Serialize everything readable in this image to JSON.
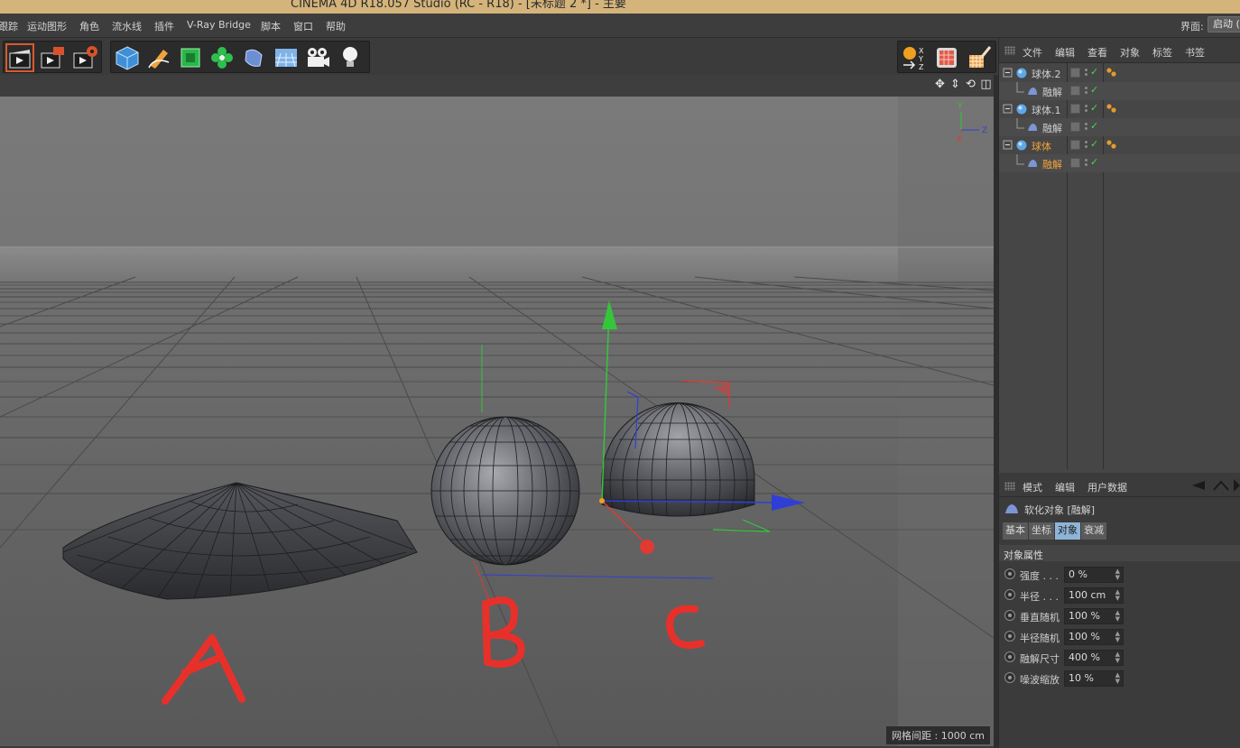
{
  "window": {
    "title": "CINEMA 4D R18.057 Studio (RC - R18) - [未标题 2 *] - 主要"
  },
  "menubar": {
    "items": [
      "跟踪",
      "运动图形",
      "角色",
      "流水线",
      "插件",
      "V-Ray Bridge",
      "脚本",
      "窗口",
      "帮助"
    ],
    "layout_label": "界面:",
    "layout_value": "启动 ("
  },
  "toolbar": {
    "groups": [
      [
        "render-active-view-icon",
        "render-to-picture-viewer-icon",
        "render-settings-icon"
      ],
      [
        "cube-primitive-icon",
        "pen-spline-icon",
        "subdivision-surface-icon",
        "cloner-icon",
        "bend-deformer-icon",
        "floor-environment-icon",
        "camera-icon",
        "light-icon"
      ],
      [
        "coordinate-system-icon",
        "texture-mode-icon",
        "paint-mode-icon"
      ]
    ]
  },
  "viewport": {
    "nav_icons": [
      "move-view-icon",
      "zoom-view-icon",
      "rotate-view-icon",
      "toggle-view-icon"
    ],
    "grid_readout": "网格间距 : 1000 cm",
    "axis_labels": {
      "y": "Y",
      "z": "Z",
      "x": "X"
    },
    "annotations": [
      "A",
      "B",
      "C"
    ]
  },
  "object_manager": {
    "menu": [
      "文件",
      "编辑",
      "查看",
      "对象",
      "标签",
      "书签"
    ],
    "objects": [
      {
        "name": "球体.2",
        "kind": "sphere",
        "level": 0,
        "selected": false
      },
      {
        "name": "融解",
        "kind": "melt",
        "level": 1,
        "selected": false
      },
      {
        "name": "球体.1",
        "kind": "sphere",
        "level": 0,
        "selected": false
      },
      {
        "name": "融解",
        "kind": "melt",
        "level": 1,
        "selected": false
      },
      {
        "name": "球体",
        "kind": "sphere",
        "level": 0,
        "selected": true
      },
      {
        "name": "融解",
        "kind": "melt",
        "level": 1,
        "selected": true
      }
    ]
  },
  "attribute_manager": {
    "menu": [
      "模式",
      "编辑",
      "用户数据"
    ],
    "title": "软化对象 [融解]",
    "tabs": [
      "基本",
      "坐标",
      "对象",
      "衰减"
    ],
    "active_tab": "对象",
    "section": "对象属性",
    "properties": [
      {
        "label": "强度 . . .",
        "value": "0 %"
      },
      {
        "label": "半径 . . .",
        "value": "100 cm"
      },
      {
        "label": "垂直随机",
        "value": "100 %"
      },
      {
        "label": "半径随机",
        "value": "100 %"
      },
      {
        "label": "融解尺寸",
        "value": "400 %"
      },
      {
        "label": "噪波缩放",
        "value": "10 %"
      }
    ]
  },
  "colors": {
    "title_bar": "#d4b47a",
    "selected_text": "#f2a33a",
    "active_tab": "#8eb4d8",
    "annotation_red": "#e8302a",
    "axis_y": "#35c53b",
    "axis_x": "#e03a32",
    "axis_z": "#2f3fd6"
  }
}
